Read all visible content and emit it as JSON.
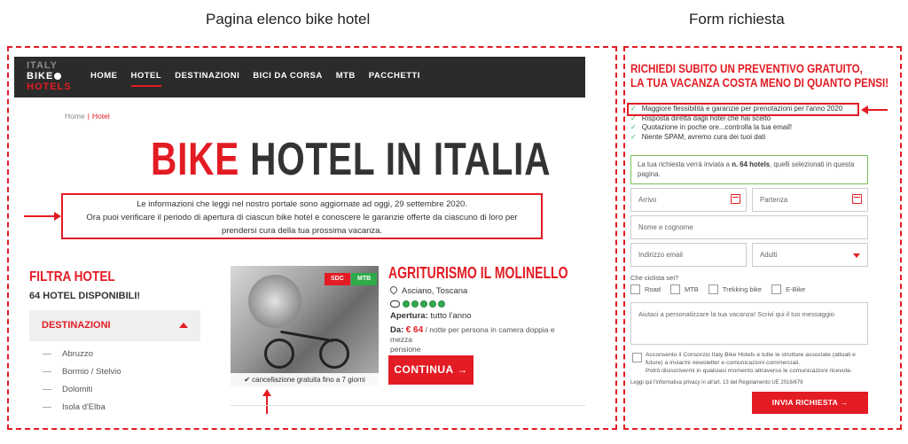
{
  "captions": {
    "left": "Pagina elenco bike hotel",
    "right": "Form richiesta"
  },
  "logo": {
    "line1": "ITALY",
    "line2": "BIKE",
    "line3": "HOTELS"
  },
  "nav": {
    "items": [
      "HOME",
      "HOTEL",
      "DESTINAZIONI",
      "BICI DA CORSA",
      "MTB",
      "PACCHETTI"
    ],
    "active": "HOTEL"
  },
  "breadcrumb": {
    "home": "Home",
    "sep": "|",
    "current": "Hotel"
  },
  "hero": {
    "red": "BIKE",
    "dark": "HOTEL IN ITALIA"
  },
  "info": {
    "line1": "Le informazioni che leggi nel nostro portale sono aggiornate ad oggi, 29 settembre 2020.",
    "line2": "Ora puoi verificare il periodo di apertura di ciascun bike hotel e conoscere le garanzie offerte da ciascuno di loro per",
    "line3": "prendersi cura della tua prossima vacanza."
  },
  "filter": {
    "title": "FILTRA HOTEL",
    "count": "64 HOTEL DISPONIBILI!",
    "section": "DESTINAZIONI",
    "destinations": [
      "Abruzzo",
      "Bormio / Stelvio",
      "Dolomiti",
      "Isola d'Elba"
    ]
  },
  "hotel": {
    "badges": [
      "SDC",
      "MTB"
    ],
    "cancellation": "cancellazione gratuita fino a 7 giorni",
    "name": "AGRITURISMO IL MOLINELLO",
    "location": "Asciano, Toscana",
    "rating": 5,
    "opening_label": "Apertura:",
    "opening_value": "tutto l'anno",
    "price_label": "Da:",
    "price_amount": "€ 64",
    "price_note": "/ notte per persona in camera doppia e mezza",
    "price_note2": "pensione",
    "cta": "CONTINUA →"
  },
  "form": {
    "title_line1": "RICHIEDI SUBITO UN PREVENTIVO GRATUITO,",
    "title_line2": "LA TUA VACANZA COSTA MENO DI QUANTO PENSI!",
    "benefits": [
      "Maggiore flessibilità e garanzie per prenotazioni per l'anno 2020",
      "Risposta diretta dagli hotel che hai scelto",
      "Quotazione in poche ore...controlla la tua email!",
      "Niente SPAM, avremo cura dei tuoi dati"
    ],
    "notice_pre": "La tua richiesta verrà inviata a ",
    "notice_bold": "n. 64 hotels",
    "notice_post": ", quelli selezionati in questa",
    "notice_line2": "pagina.",
    "arrival_placeholder": "Arrivo",
    "departure_placeholder": "Partenza",
    "name_placeholder": "Nome e cognome",
    "email_placeholder": "Indirizzo email",
    "adults_value": "Adulti",
    "cyclist_label": "Che ciclista sei?",
    "cyclist_options": [
      "Road",
      "MTB",
      "Trekking bike",
      "E-Bike"
    ],
    "message_placeholder": "Aiutaci a personalizzare la tua vacanza! Scrivi qui il tuo messaggio",
    "consent_line1": "Acconsento il Consorzio Italy Bike Hotels e tutte le strutture associate (attuali e",
    "consent_line2": "future) a inviarmi newsletter e comunicazioni commerciali.",
    "consent_line3": "Potrò disiscrivermi in qualsiasi momento attraverso le comunicazioni ricevute.",
    "privacy": "Leggi qui l'informativa privacy in all'art. 13 del Regolamento UE 2016/679",
    "submit": "INVIA RICHIESTA →"
  },
  "colors": {
    "accent": "#e31b23",
    "nav_bg": "#2b2b2b",
    "success": "#34a853"
  }
}
